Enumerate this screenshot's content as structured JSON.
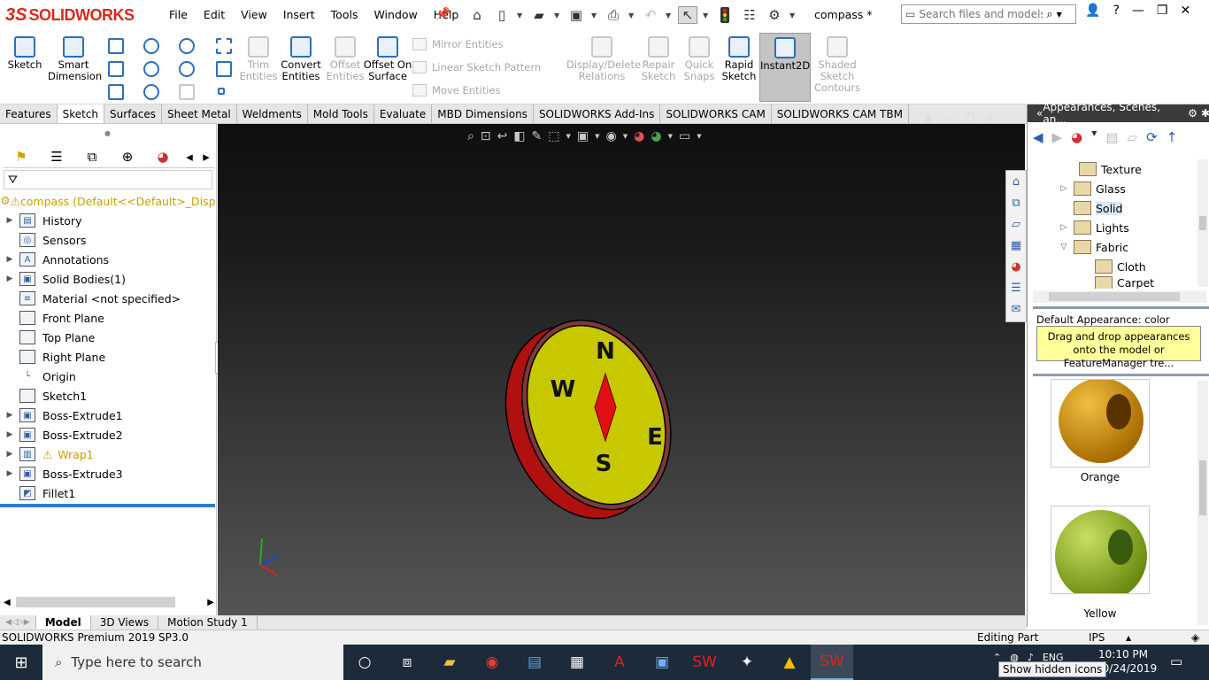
{
  "app": {
    "logo_ds": "3S",
    "logo_text": "SOLIDWORKS",
    "doc_title": "compass *",
    "menu": [
      "File",
      "Edit",
      "View",
      "Insert",
      "Tools",
      "Window",
      "Help"
    ],
    "search_placeholder": "Search files and models"
  },
  "command_manager": {
    "sketch": "Sketch",
    "smart_dimension": "Smart Dimension",
    "trim_entities": "Trim Entities",
    "convert_entities": "Convert Entities",
    "offset_entities": "Offset Entities",
    "offset_on_surface": "Offset On Surface",
    "mirror_entities": "Mirror Entities",
    "linear_sketch_pattern": "Linear Sketch Pattern",
    "move_entities": "Move Entities",
    "display_delete_relations": "Display/Delete Relations",
    "repair_sketch": "Repair Sketch",
    "quick_snaps": "Quick Snaps",
    "rapid_sketch": "Rapid Sketch",
    "instant2d": "Instant2D",
    "shaded_sketch_contours": "Shaded Sketch Contours"
  },
  "tabs": [
    "Features",
    "Sketch",
    "Surfaces",
    "Sheet Metal",
    "Weldments",
    "Mold Tools",
    "Evaluate",
    "MBD Dimensions",
    "SOLIDWORKS Add-Ins",
    "SOLIDWORKS CAM",
    "SOLIDWORKS CAM TBM"
  ],
  "active_tab": "Sketch",
  "feature_tree": {
    "root": "compass  (Default<<Default>_Displ",
    "items": [
      {
        "label": "History",
        "expandable": true
      },
      {
        "label": "Sensors",
        "expandable": false
      },
      {
        "label": "Annotations",
        "expandable": true
      },
      {
        "label": "Solid Bodies(1)",
        "expandable": true
      },
      {
        "label": "Material <not specified>",
        "expandable": false
      },
      {
        "label": "Front Plane",
        "expandable": false
      },
      {
        "label": "Top Plane",
        "expandable": false
      },
      {
        "label": "Right Plane",
        "expandable": false
      },
      {
        "label": "Origin",
        "expandable": false
      },
      {
        "label": "Sketch1",
        "expandable": false
      },
      {
        "label": "Boss-Extrude1",
        "expandable": true
      },
      {
        "label": "Boss-Extrude2",
        "expandable": true
      },
      {
        "label": "Wrap1",
        "expandable": true,
        "warning": true
      },
      {
        "label": "Boss-Extrude3",
        "expandable": true
      },
      {
        "label": "Fillet1",
        "expandable": false
      }
    ]
  },
  "task_pane": {
    "title": "Appearances, Scenes, an...",
    "tree": [
      {
        "label": "Texture",
        "indent": 2,
        "expander": ""
      },
      {
        "label": "Glass",
        "indent": 1,
        "expander": ">"
      },
      {
        "label": "Solid",
        "indent": 1,
        "expander": "",
        "selected": true
      },
      {
        "label": "Lights",
        "indent": 1,
        "expander": ">"
      },
      {
        "label": "Fabric",
        "indent": 1,
        "expander": "v"
      },
      {
        "label": "Cloth",
        "indent": 2,
        "expander": ""
      },
      {
        "label": "Carpet",
        "indent": 2,
        "expander": ""
      }
    ],
    "default_appearance": "Default Appearance: color",
    "tooltip": "Drag and drop appearances onto the model or FeatureManager tre...",
    "swatches": [
      {
        "label": "Orange",
        "color": "#d89a10"
      },
      {
        "label": "Yellow",
        "color": "#9cb830"
      }
    ]
  },
  "bottom_tabs": [
    "Model",
    "3D Views",
    "Motion Study 1"
  ],
  "status": {
    "version": "SOLIDWORKS Premium 2019 SP3.0",
    "mode": "Editing Part",
    "units": "IPS"
  },
  "taskbar": {
    "search_placeholder": "Type here to search",
    "time": "10:10 PM",
    "date": "10/24/2019",
    "lang": "ENG",
    "hidden_icons_tip": "Show hidden icons"
  },
  "compass_model": {
    "rim_color": "#b01010",
    "face_color": "#c8c800",
    "needle_color": "#e01010",
    "letters": [
      "N",
      "E",
      "S",
      "W"
    ]
  }
}
